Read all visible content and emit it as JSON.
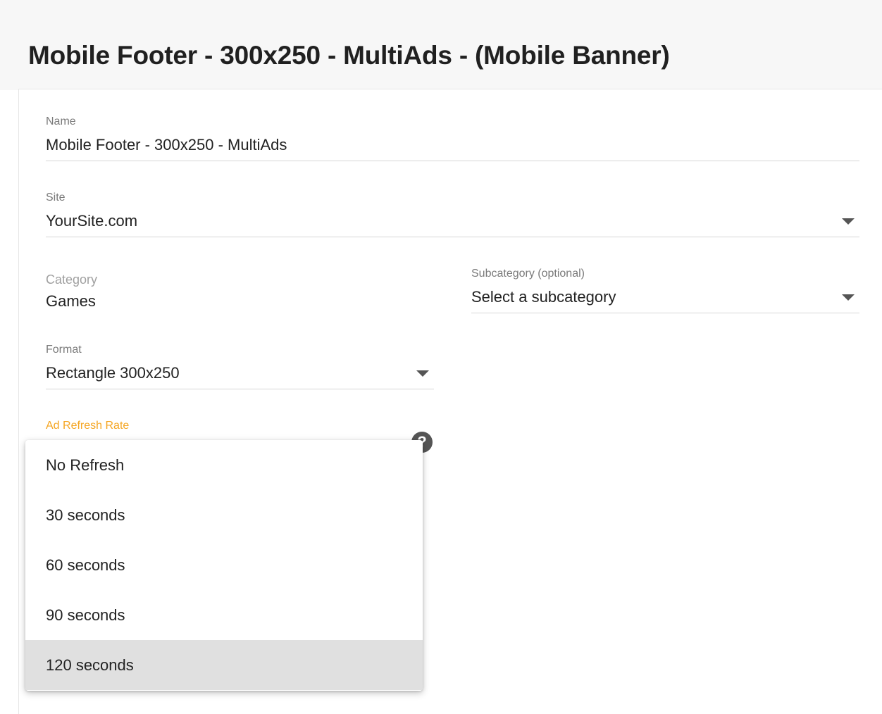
{
  "page": {
    "title": "Mobile Footer - 300x250 - MultiAds - (Mobile Banner)"
  },
  "form": {
    "name": {
      "label": "Name",
      "value": "Mobile Footer - 300x250 - MultiAds"
    },
    "site": {
      "label": "Site",
      "value": "YourSite.com"
    },
    "category": {
      "label": "Category",
      "value": "Games"
    },
    "subcategory": {
      "label": "Subcategory (optional)",
      "value": "Select a subcategory"
    },
    "format": {
      "label": "Format",
      "value": "Rectangle 300x250"
    },
    "ad_refresh_rate": {
      "label": "Ad Refresh Rate",
      "label_color": "#f5a623",
      "help_icon": "help-circle-icon",
      "options": [
        {
          "label": "No Refresh",
          "highlighted": false
        },
        {
          "label": "30 seconds",
          "highlighted": false
        },
        {
          "label": "60 seconds",
          "highlighted": false
        },
        {
          "label": "90 seconds",
          "highlighted": false
        },
        {
          "label": "120 seconds",
          "highlighted": true
        }
      ]
    }
  },
  "icons": {
    "dropdown": "caret-down-icon"
  },
  "colors": {
    "header_background": "#f7f7f7",
    "focus_accent": "#f5a623",
    "highlight_row": "#e0e0e0"
  }
}
